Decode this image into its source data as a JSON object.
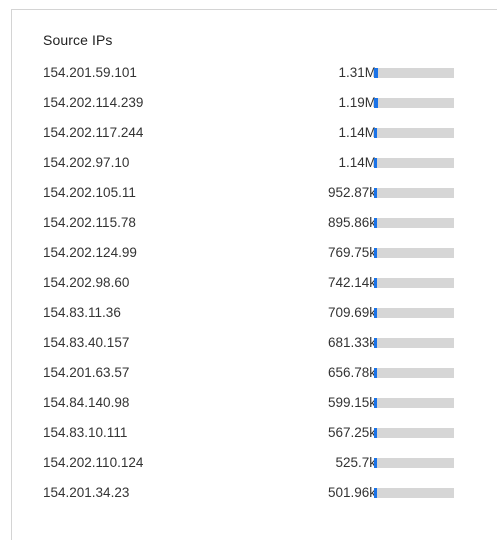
{
  "panel": {
    "title": "Source IPs"
  },
  "accent_color": "#1a73e8",
  "track_color": "#d6d6d6",
  "rows": [
    {
      "ip": "154.201.59.101",
      "value": "1.31M",
      "share": 0.05
    },
    {
      "ip": "154.202.114.239",
      "value": "1.19M",
      "share": 0.045
    },
    {
      "ip": "154.202.117.244",
      "value": "1.14M",
      "share": 0.043
    },
    {
      "ip": "154.202.97.10",
      "value": "1.14M",
      "share": 0.043
    },
    {
      "ip": "154.202.105.11",
      "value": "952.87k",
      "share": 0.036
    },
    {
      "ip": "154.202.115.78",
      "value": "895.86k",
      "share": 0.034
    },
    {
      "ip": "154.202.124.99",
      "value": "769.75k",
      "share": 0.029
    },
    {
      "ip": "154.202.98.60",
      "value": "742.14k",
      "share": 0.028
    },
    {
      "ip": "154.83.11.36",
      "value": "709.69k",
      "share": 0.027
    },
    {
      "ip": "154.83.40.157",
      "value": "681.33k",
      "share": 0.026
    },
    {
      "ip": "154.201.63.57",
      "value": "656.78k",
      "share": 0.025
    },
    {
      "ip": "154.84.140.98",
      "value": "599.15k",
      "share": 0.023
    },
    {
      "ip": "154.83.10.111",
      "value": "567.25k",
      "share": 0.022
    },
    {
      "ip": "154.202.110.124",
      "value": "525.7k",
      "share": 0.02
    },
    {
      "ip": "154.201.34.23",
      "value": "501.96k",
      "share": 0.019
    }
  ]
}
